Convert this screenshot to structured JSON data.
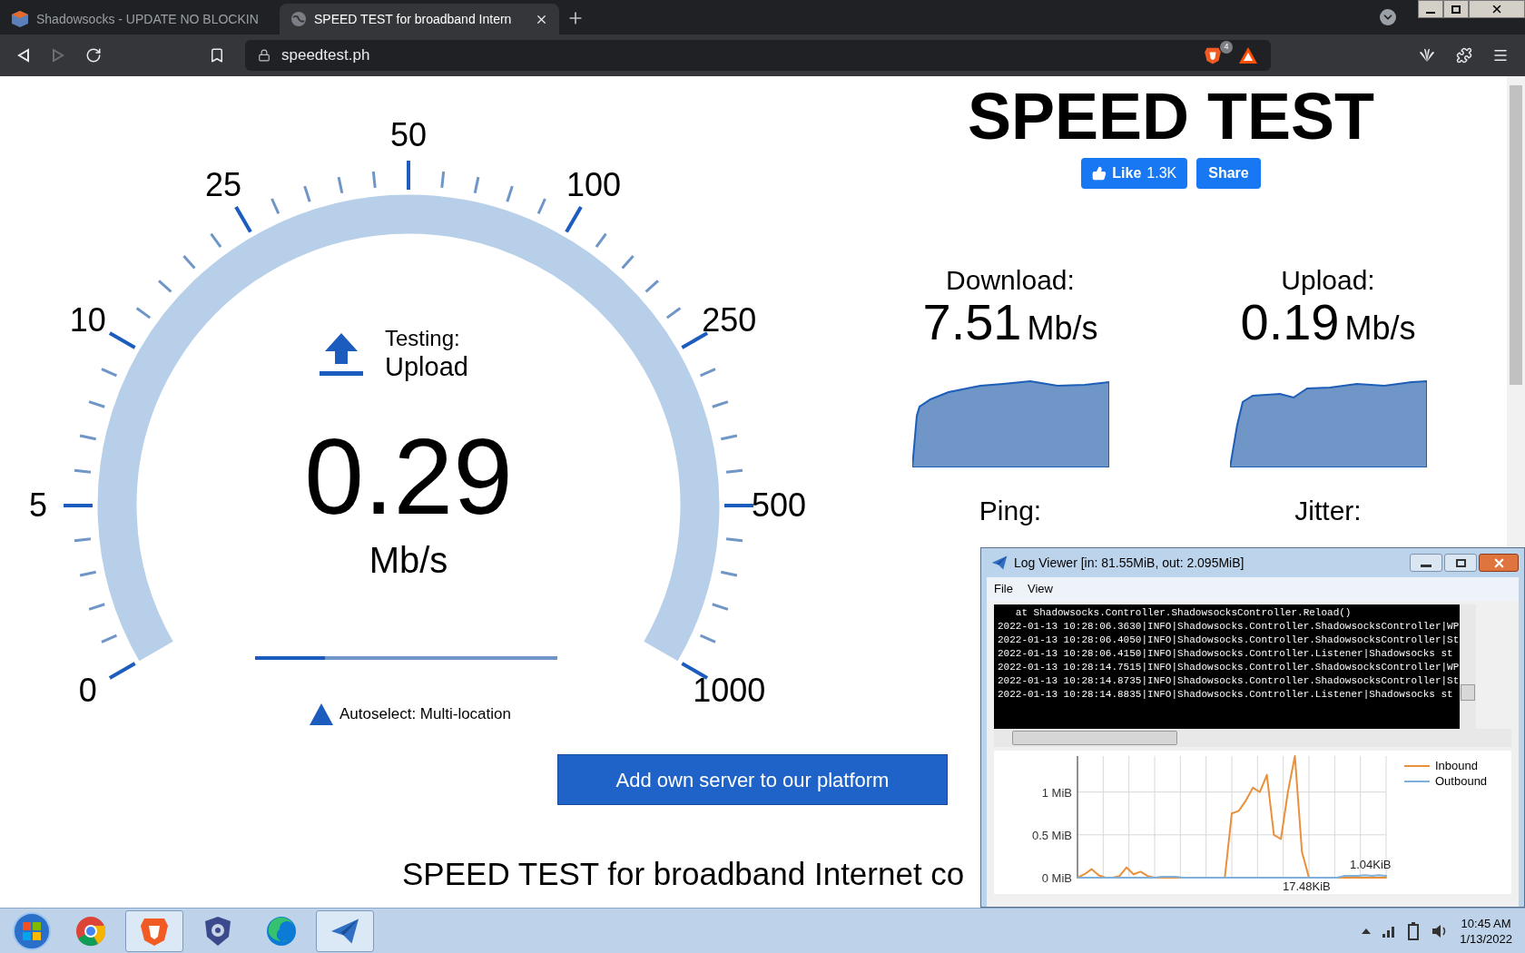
{
  "browser": {
    "tabs": [
      {
        "title": "Shadowsocks - UPDATE NO BLOCKIN",
        "selected": false
      },
      {
        "title": "SPEED TEST for broadband Intern",
        "selected": true
      }
    ],
    "address": "speedtest.ph",
    "shields_count": "4"
  },
  "page": {
    "title": "SPEED TEST",
    "like_button": {
      "label": "Like",
      "count": "1.3K"
    },
    "share_button": "Share",
    "gauge": {
      "ticks": [
        "0",
        "5",
        "10",
        "25",
        "50",
        "100",
        "250",
        "500",
        "1000"
      ],
      "status_label": "Testing:",
      "status_value": "Upload",
      "speed": "0.29",
      "unit": "Mb/s",
      "progress": {
        "level": 0.23
      },
      "server": "Autoselect: Multi-location"
    },
    "results": [
      {
        "kind": "graph",
        "label": "Download:",
        "value": "7.51",
        "unit": "Mb/s"
      },
      {
        "kind": "graph",
        "label": "Upload:",
        "value": "0.19",
        "unit": "Mb/s"
      },
      {
        "kind": "plain",
        "label": "Ping:"
      },
      {
        "kind": "plain",
        "label": "Jitter:"
      }
    ],
    "add_server_button": "Add own server to our platform",
    "footer_heading": "SPEED TEST for broadband Internet co"
  },
  "log_viewer": {
    "title": "Log Viewer [in: 81.55MiB, out: 2.095MiB]",
    "menu": [
      "File",
      "View"
    ],
    "log_lines": [
      "   at Shadowsocks.Controller.ShadowsocksController.Reload()",
      "2022-01-13 10:28:06.3630|INFO|Shadowsocks.Controller.ShadowsocksController|WP",
      "2022-01-13 10:28:06.4050|INFO|Shadowsocks.Controller.ShadowsocksController|St",
      "2022-01-13 10:28:06.4150|INFO|Shadowsocks.Controller.Listener|Shadowsocks st",
      "2022-01-13 10:28:14.7515|INFO|Shadowsocks.Controller.ShadowsocksController|WP",
      "2022-01-13 10:28:14.8735|INFO|Shadowsocks.Controller.ShadowsocksController|St",
      "2022-01-13 10:28:14.8835|INFO|Shadowsocks.Controller.Listener|Shadowsocks st"
    ],
    "chart_data": {
      "type": "line",
      "grid": true,
      "legend": "right",
      "ylim": [
        0,
        1.42
      ],
      "yticks": [
        {
          "value": 0,
          "label": "0 MiB"
        },
        {
          "value": 0.5,
          "label": "0.5 MiB"
        },
        {
          "value": 1,
          "label": "1 MiB"
        }
      ],
      "series": [
        {
          "name": "Inbound",
          "color": "#e8903a",
          "values": [
            0,
            0.04,
            0.1,
            0.03,
            0,
            0,
            0.02,
            0.12,
            0.04,
            0.07,
            0.02,
            0,
            0,
            0,
            0,
            0,
            0,
            0,
            0,
            0,
            0,
            0,
            0.75,
            0.78,
            0.9,
            1.05,
            1.0,
            1.2,
            0.5,
            0.45,
            1.0,
            1.42,
            0.3,
            0,
            0,
            0,
            0,
            0,
            0,
            0,
            0,
            0,
            0,
            0,
            0
          ]
        },
        {
          "name": "Outbound",
          "color": "#7fb0dc",
          "values": [
            0,
            0,
            0,
            0,
            0,
            0,
            0,
            0,
            0,
            0,
            0,
            0,
            0.01,
            0.01,
            0.01,
            0,
            0,
            0,
            0,
            0,
            0,
            0,
            0,
            0,
            0,
            0,
            0,
            0,
            0,
            0,
            0,
            0,
            0,
            0,
            0,
            0,
            0,
            0,
            0.02,
            0.02,
            0.02,
            0.03,
            0.02,
            0.03,
            0.02
          ]
        }
      ],
      "annotations": [
        "17.48KiB",
        "1.04KiB"
      ]
    }
  },
  "taskbar": {
    "apps": [
      {
        "kind": "chrome",
        "running": false
      },
      {
        "kind": "brave",
        "running": true
      },
      {
        "kind": "shield",
        "running": false
      },
      {
        "kind": "edge",
        "running": false
      },
      {
        "kind": "plane",
        "running": true
      }
    ],
    "time": "10:45 AM",
    "date": "1/13/2022"
  }
}
